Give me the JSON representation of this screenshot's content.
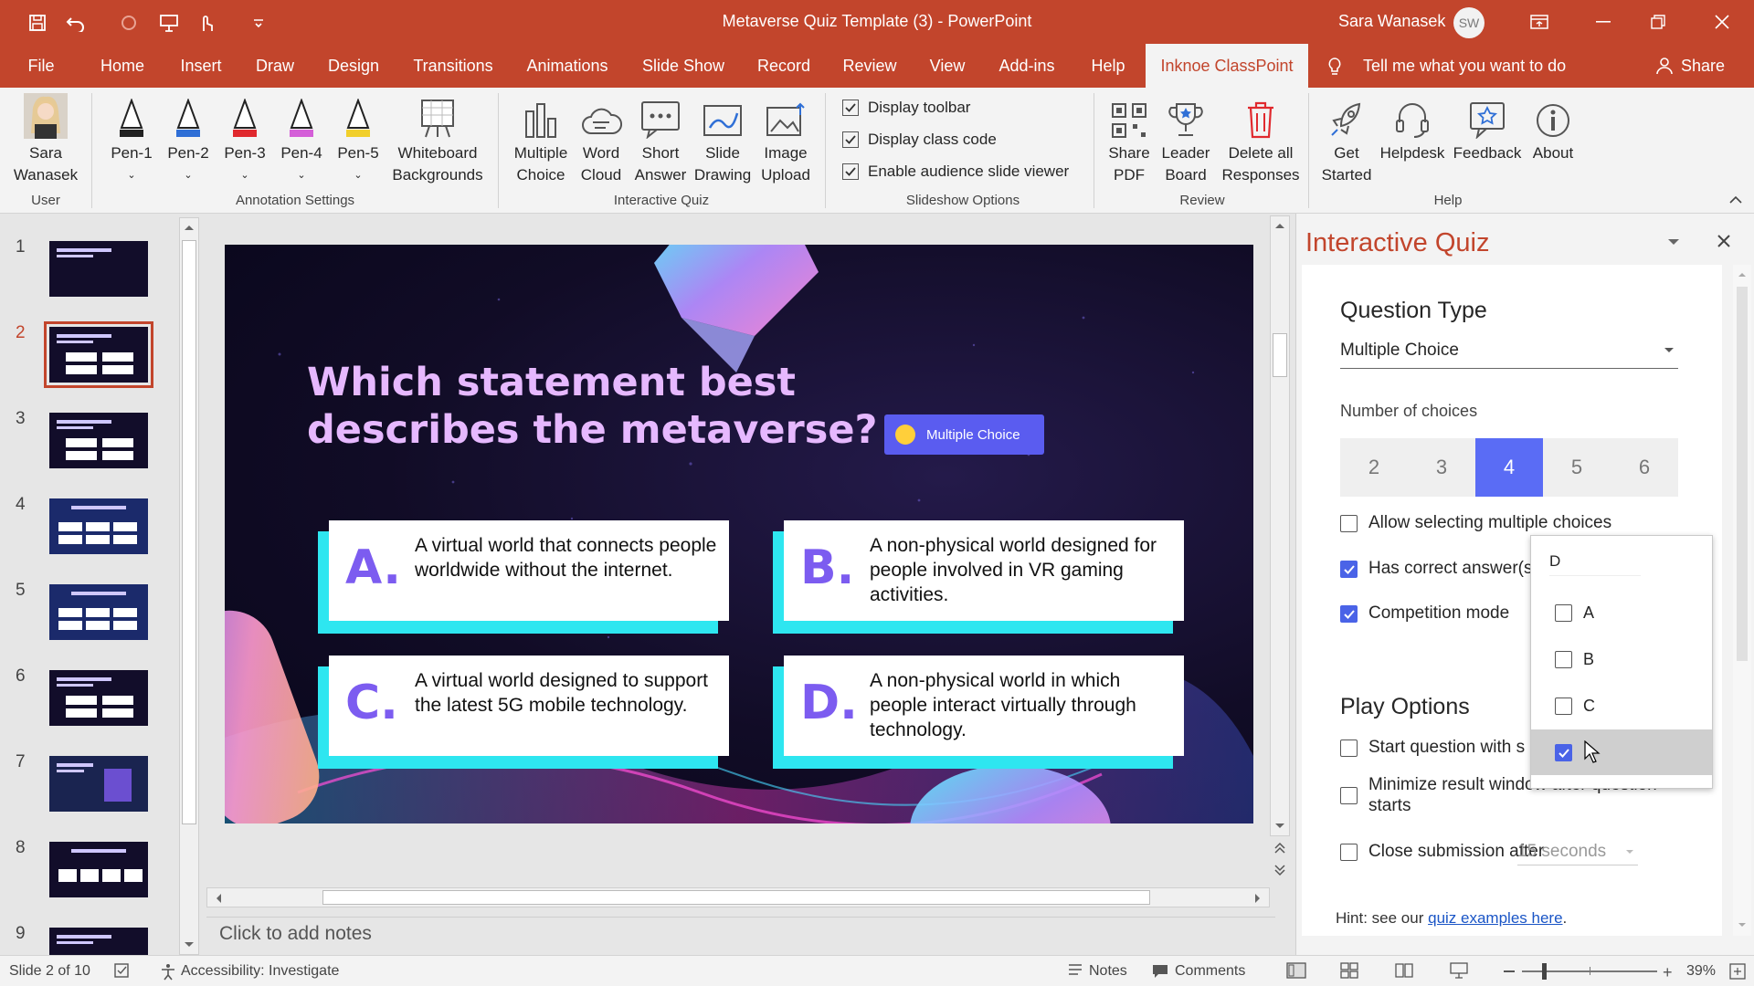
{
  "window": {
    "title": "Metaverse Quiz Template (3)  -  PowerPoint",
    "user_name": "Sara Wanasek",
    "user_initials": "SW"
  },
  "menu_tabs": [
    "File",
    "Home",
    "Insert",
    "Draw",
    "Design",
    "Transitions",
    "Animations",
    "Slide Show",
    "Record",
    "Review",
    "View",
    "Add-ins",
    "Help",
    "Inknoe ClassPoint"
  ],
  "tell_me": "Tell me what you want to do",
  "share": "Share",
  "ribbon": {
    "user_group": {
      "label": "User",
      "name_line1": "Sara",
      "name_line2": "Wanasek"
    },
    "annotation_group": {
      "label": "Annotation Settings",
      "pens": [
        "Pen-1",
        "Pen-2",
        "Pen-3",
        "Pen-4",
        "Pen-5"
      ],
      "pen_colors": [
        "#222222",
        "#2f6fd6",
        "#e0292e",
        "#d45fd8",
        "#f1cf2b"
      ],
      "whiteboard_line1": "Whiteboard",
      "whiteboard_line2": "Backgrounds"
    },
    "quiz_group": {
      "label": "Interactive Quiz",
      "buttons": [
        {
          "l1": "Multiple",
          "l2": "Choice"
        },
        {
          "l1": "Word",
          "l2": "Cloud"
        },
        {
          "l1": "Short",
          "l2": "Answer"
        },
        {
          "l1": "Slide",
          "l2": "Drawing"
        },
        {
          "l1": "Image",
          "l2": "Upload"
        }
      ]
    },
    "slideshow_group": {
      "label": "Slideshow Options",
      "options": [
        "Display toolbar",
        "Display class code",
        "Enable audience slide viewer"
      ]
    },
    "review_group": {
      "label": "Review",
      "buttons": [
        {
          "l1": "Share",
          "l2": "PDF"
        },
        {
          "l1": "Leader",
          "l2": "Board"
        },
        {
          "l1": "Delete all",
          "l2": "Responses"
        }
      ]
    },
    "help_group": {
      "label": "Help",
      "buttons": [
        {
          "l1": "Get",
          "l2": "Started"
        },
        {
          "l1": "Helpdesk",
          "l2": ""
        },
        {
          "l1": "Feedback",
          "l2": ""
        },
        {
          "l1": "About",
          "l2": ""
        }
      ]
    }
  },
  "thumbnails": [
    "1",
    "2",
    "3",
    "4",
    "5",
    "6",
    "7",
    "8",
    "9"
  ],
  "slide": {
    "question": "Which statement best describes the metaverse?",
    "badge": "Multiple Choice",
    "answers": [
      {
        "letter": "A.",
        "text": "A virtual world that connects people worldwide without the internet."
      },
      {
        "letter": "B.",
        "text": "A non-physical world designed for people involved in VR gaming activities."
      },
      {
        "letter": "C.",
        "text": "A virtual world designed to support the latest 5G mobile technology."
      },
      {
        "letter": "D.",
        "text": "A non-physical world in which people interact virtually through technology."
      }
    ]
  },
  "notes_placeholder": "Click to add notes",
  "pane": {
    "title": "Interactive Quiz",
    "question_type_heading": "Question Type",
    "question_type_value": "Multiple Choice",
    "num_choices_label": "Number of choices",
    "choices": [
      "2",
      "3",
      "4",
      "5",
      "6"
    ],
    "selected_choice": "4",
    "allow_multiple": "Allow selecting multiple choices",
    "has_correct": "Has correct answer(s",
    "competition": "Competition mode",
    "play_options_heading": "Play Options",
    "start_question": "Start question with s",
    "minimize_result": "Minimize result window after question starts",
    "close_submission": "Close submission after",
    "close_submission_value": "15 seconds",
    "hint_prefix": "Hint: see our ",
    "hint_link": "quiz examples here",
    "hint_suffix": "."
  },
  "correct_popup": {
    "value": "D",
    "options": [
      "A",
      "B",
      "C",
      "D"
    ],
    "checked": "D"
  },
  "status": {
    "slide_info": "Slide 2 of 10",
    "accessibility": "Accessibility: Investigate",
    "notes": "Notes",
    "comments": "Comments",
    "zoom": "39%"
  },
  "colors": {
    "accent": "#c2452c",
    "quiz_blue": "#5a6cf5",
    "slide_title": "#e6b8ff",
    "answer_letter": "#7c5cf0",
    "answer_shadow": "#2ee6f0"
  }
}
